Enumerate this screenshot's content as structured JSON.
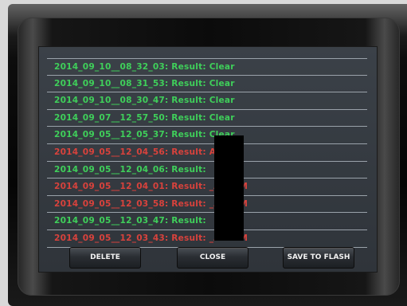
{
  "log": {
    "entries": [
      {
        "text": "2014_09_10__08_32_03: Result: Clear",
        "status": "clear"
      },
      {
        "text": "2014_09_10__08_31_53: Result: Clear",
        "status": "clear"
      },
      {
        "text": "2014_09_10__08_30_47: Result: Clear",
        "status": "clear"
      },
      {
        "text": "2014_09_07__12_57_50: Result: Clear",
        "status": "clear"
      },
      {
        "text": "2014_09_05__12_05_37: Result: Clear",
        "status": "clear"
      },
      {
        "text": "2014_09_05__12_04_56: Result:        ALARM",
        "status": "alarm"
      },
      {
        "text": "2014_09_05__12_04_06: Result:",
        "status": "clear"
      },
      {
        "text": "2014_09_05__12_04_01: Result:        _ALARM",
        "status": "alarm"
      },
      {
        "text": "2014_09_05__12_03_58: Result:        _ALARM",
        "status": "alarm"
      },
      {
        "text": "2014_09_05__12_03_47: Result:",
        "status": "clear"
      },
      {
        "text": "2014_09_05__12_03_43: Result:        _ALARM",
        "status": "alarm"
      }
    ]
  },
  "buttons": {
    "delete": "DELETE",
    "close": "CLOSE",
    "save_to_flash": "SAVE TO FLASH"
  },
  "colors": {
    "clear": "#3fcf5a",
    "alarm": "#d8423c",
    "screen": "#353a40"
  }
}
